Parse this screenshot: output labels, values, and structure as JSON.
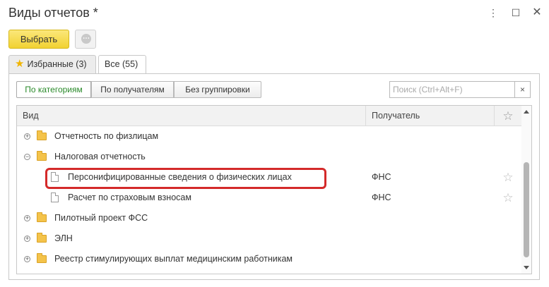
{
  "window": {
    "title": "Виды отчетов *",
    "more_icon": "vertical-dots-icon",
    "maximize_icon": "maximize-icon",
    "close_icon": "close-icon"
  },
  "toolbar": {
    "select_label": "Выбрать",
    "more_icon": "more-actions-icon"
  },
  "tabs": [
    {
      "label": "Избранные (3)",
      "icon": "star-icon"
    },
    {
      "label": "Все (55)"
    }
  ],
  "grouping": [
    {
      "label": "По категориям",
      "active": true
    },
    {
      "label": "По получателям"
    },
    {
      "label": "Без группировки"
    }
  ],
  "search": {
    "placeholder": "Поиск (Ctrl+Alt+F)",
    "clear_label": "×"
  },
  "table": {
    "columns": [
      "Вид",
      "Получатель",
      "☆"
    ],
    "rows": [
      {
        "type": "group",
        "state": "collapsed",
        "name": "Отчетность по физлицам",
        "recipient": ""
      },
      {
        "type": "group",
        "state": "expanded",
        "name": "Налоговая отчетность",
        "recipient": ""
      },
      {
        "type": "report",
        "name": "Персонифицированные сведения о физических лицах",
        "recipient": "ФНС",
        "highlighted": true
      },
      {
        "type": "report",
        "name": "Расчет по страховым взносам",
        "recipient": "ФНС"
      },
      {
        "type": "group",
        "state": "collapsed",
        "name": "Пилотный проект ФСС",
        "recipient": ""
      },
      {
        "type": "group",
        "state": "collapsed",
        "name": "ЭЛН",
        "recipient": ""
      },
      {
        "type": "group",
        "state": "collapsed",
        "name": "Реестр стимулирующих выплат медицинским работникам",
        "recipient": ""
      }
    ]
  },
  "colors": {
    "accent_green": "#2a8a2a",
    "select_button": "#f1d232",
    "highlight_border": "#d42a2a"
  }
}
